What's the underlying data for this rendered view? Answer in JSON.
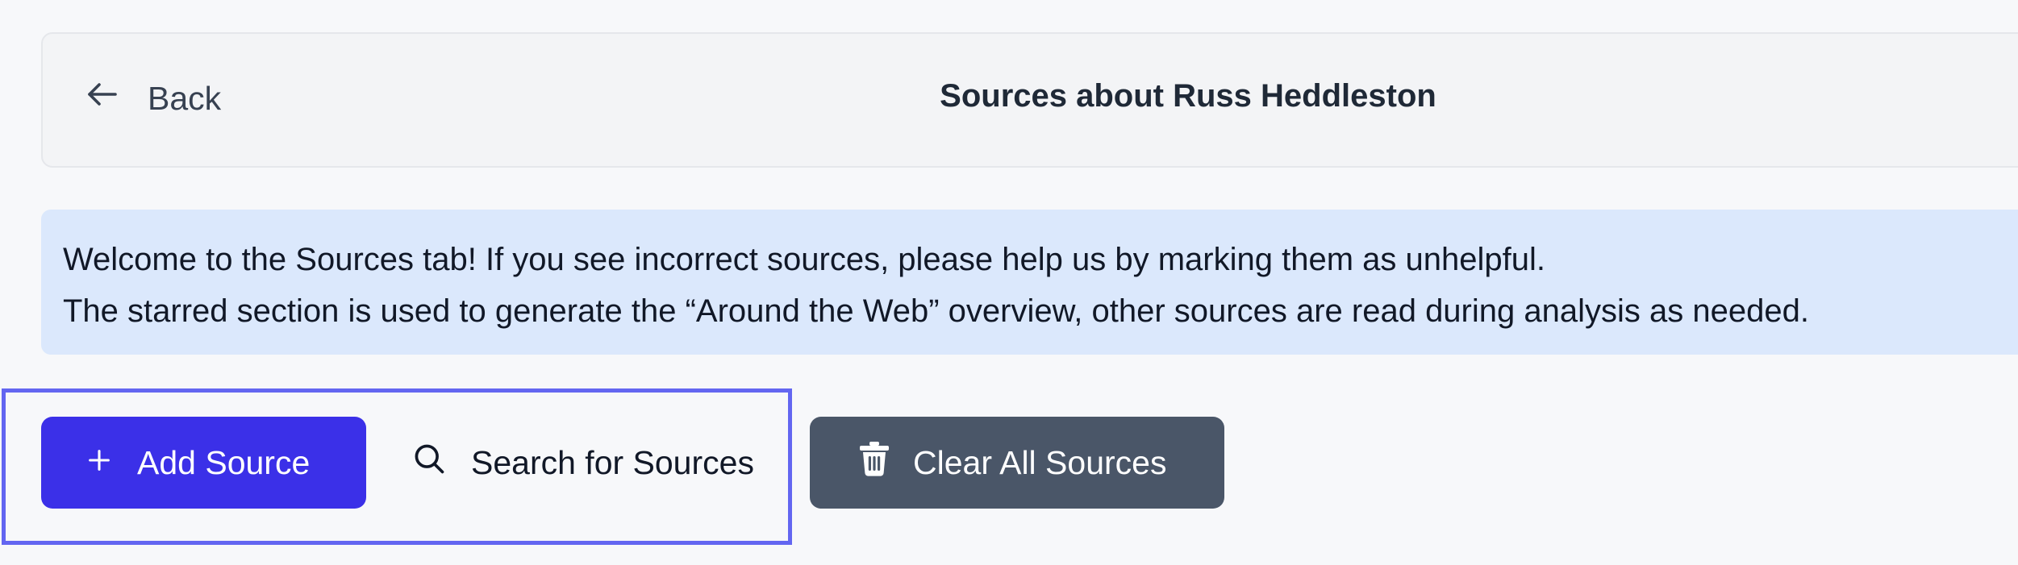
{
  "header": {
    "back_label": "Back",
    "title": "Sources about Russ Heddleston"
  },
  "banner": {
    "line1": "Welcome to the Sources tab! If you see incorrect sources, please help us by marking them as unhelpful.",
    "line2": "The starred section is used to generate the “Around the Web” overview, other sources are read during analysis as needed."
  },
  "actions": {
    "add_source": "Add Source",
    "search_sources": "Search for Sources",
    "clear_all": "Clear All Sources"
  },
  "icons": {
    "back": "arrow-left-icon",
    "add": "plus-icon",
    "search": "search-icon",
    "clear": "trash-icon"
  },
  "colors": {
    "primary": "#3b30e8",
    "secondary": "#4a5668",
    "banner_bg": "#dbe8fc",
    "highlight": "#6366f1"
  }
}
